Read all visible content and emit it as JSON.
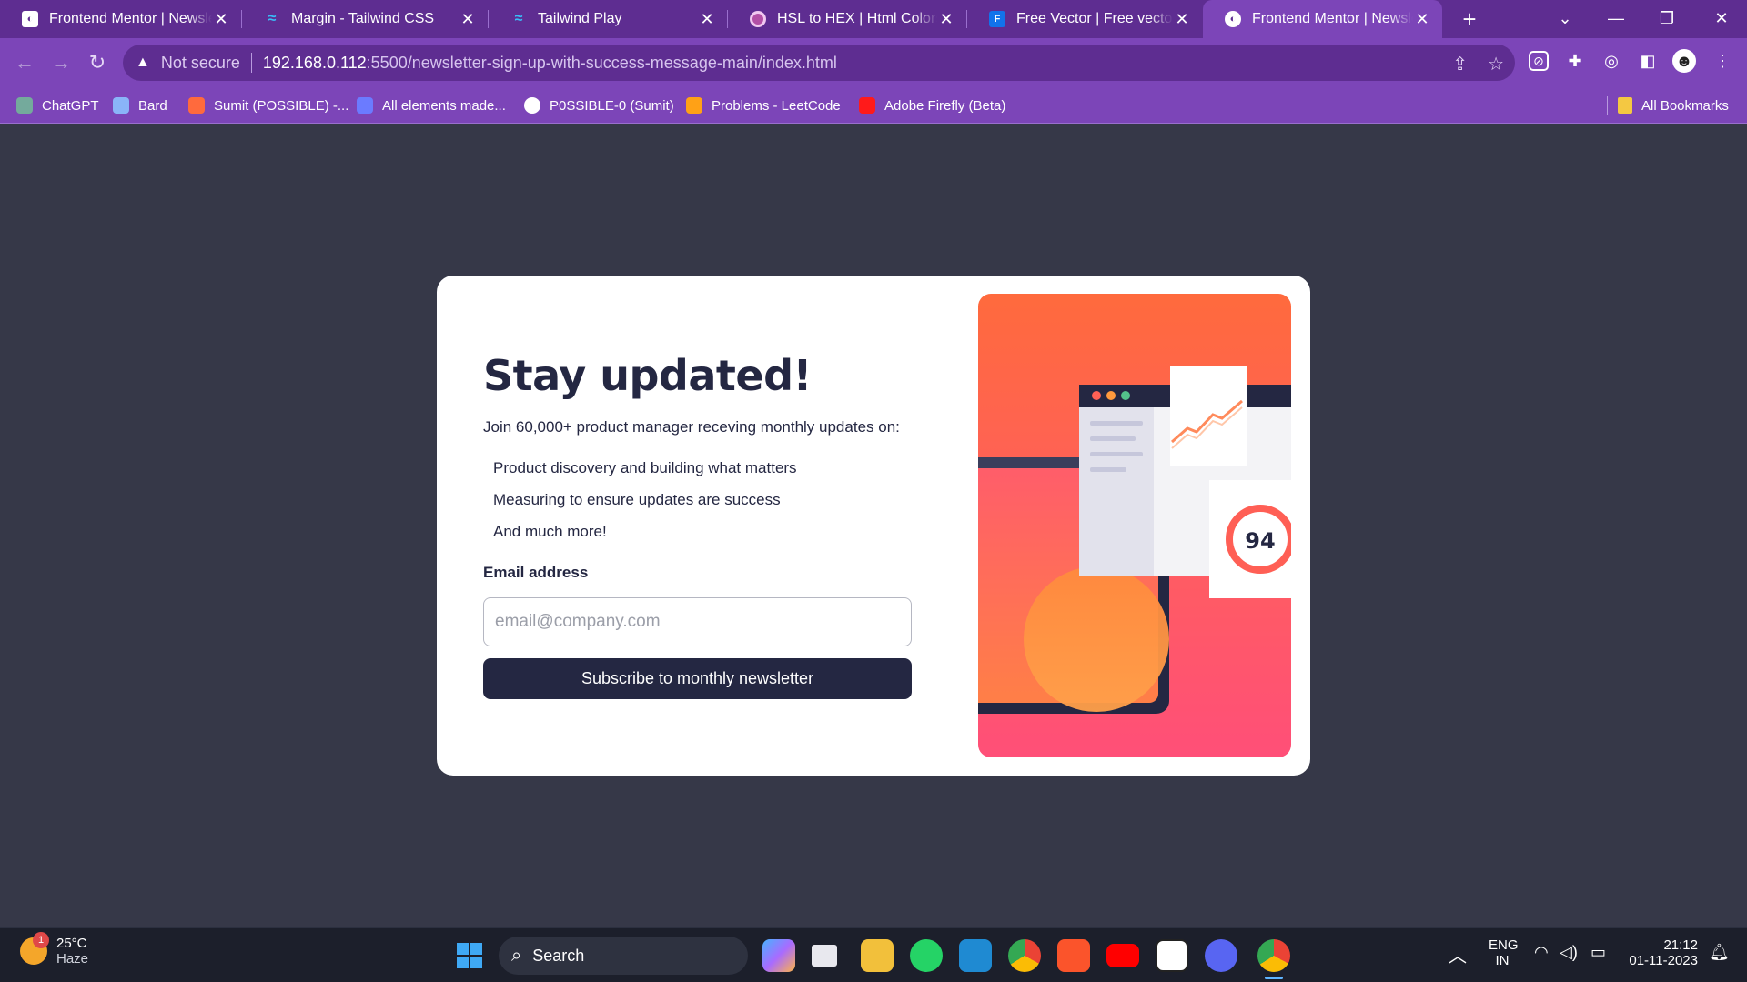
{
  "browser": {
    "tabs": [
      {
        "title": "Frontend Mentor | Newsletter sign-up",
        "icon": "frontend-mentor-icon",
        "active": false
      },
      {
        "title": "Margin - Tailwind CSS",
        "icon": "tailwind-icon",
        "active": false
      },
      {
        "title": "Tailwind Play",
        "icon": "tailwind-icon",
        "active": false
      },
      {
        "title": "HSL to HEX | Html Colors",
        "icon": "circle-icon",
        "active": false
      },
      {
        "title": "Free Vector | Free vector hand drawn",
        "icon": "freepik-icon",
        "active": false
      },
      {
        "title": "Frontend Mentor | Newsletter sign-up",
        "icon": "frontend-mentor-icon",
        "active": true
      }
    ],
    "address": {
      "security": "Not secure",
      "host": "192.168.0.112",
      "path": ":5500/newsletter-sign-up-with-success-message-main/index.html"
    },
    "bookmarks": [
      {
        "label": "ChatGPT",
        "color": "#74aa9c"
      },
      {
        "label": "Bard",
        "color": "#8ab4f8"
      },
      {
        "label": "Sumit (POSSIBLE) -...",
        "color": "#ff6a3d"
      },
      {
        "label": "All elements made...",
        "color": "#6b7bff"
      },
      {
        "label": "P0SSIBLE-0 (Sumit)",
        "color": "#ffffff"
      },
      {
        "label": "Problems - LeetCode",
        "color": "#ffa116"
      },
      {
        "label": "Adobe Firefly (Beta)",
        "color": "#ff1a1a"
      }
    ],
    "all_bookmarks": "All Bookmarks"
  },
  "page": {
    "title": "Stay updated!",
    "intro": "Join 60,000+ product manager receving monthly updates on:",
    "features": [
      "Product discovery and building what matters",
      "Measuring to ensure updates are success",
      "And much more!"
    ],
    "email_label": "Email address",
    "email_placeholder": "email@company.com",
    "email_value": "",
    "subscribe_label": "Subscribe to monthly newsletter",
    "illustration_score": "94",
    "colors": {
      "dark_navy": "#242742",
      "tomato": "#ff6155",
      "background": "#363848"
    }
  },
  "taskbar": {
    "weather_temp": "25°C",
    "weather_desc": "Haze",
    "weather_badge": "1",
    "search_label": "Search",
    "apps": [
      "copilot-icon",
      "task-view-icon",
      "file-explorer-icon",
      "whatsapp-icon",
      "vscode-icon",
      "chrome-icon",
      "brave-icon",
      "youtube-icon",
      "notion-icon",
      "discord-icon",
      "chrome-dev-icon"
    ],
    "lang_line1": "ENG",
    "lang_line2": "IN",
    "time": "21:12",
    "date": "01-11-2023"
  }
}
